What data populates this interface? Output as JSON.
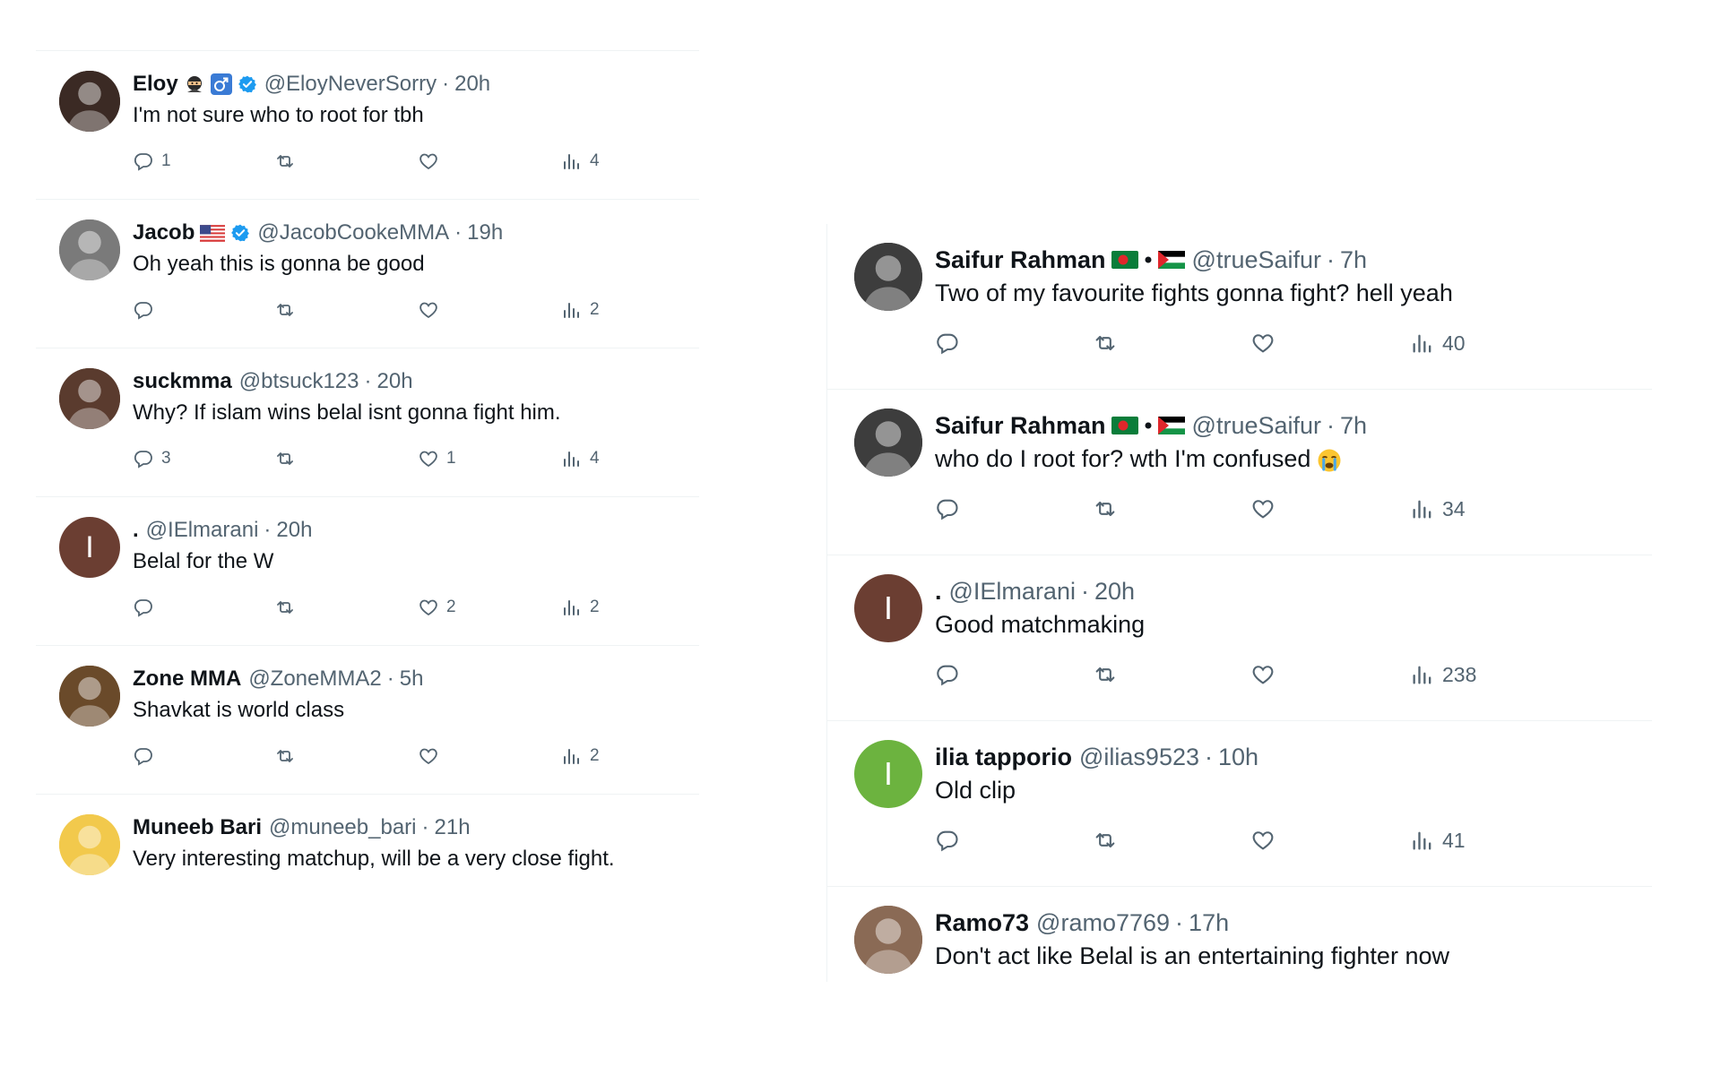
{
  "left_tweets": [
    {
      "name": "Eloy",
      "handle": "@EloyNeverSorry",
      "time": "20h",
      "text": "I'm not sure who to root for tbh",
      "replies": "1",
      "likes": "",
      "views": "4",
      "verified": true,
      "badges": [
        "ninja-emoji",
        "male-sign-emoji"
      ],
      "avatar": {
        "kind": "image",
        "icon": "avatar-eloy-icon",
        "color": "#3b2a24"
      }
    },
    {
      "name": "Jacob",
      "handle": "@JacobCookeMMA",
      "time": "19h",
      "text": "Oh yeah this is gonna be good",
      "replies": "",
      "likes": "",
      "views": "2",
      "verified": true,
      "badges": [
        "us-flag"
      ],
      "avatar": {
        "kind": "image",
        "icon": "avatar-jacob-icon",
        "color": "#7a7a7a"
      }
    },
    {
      "name": "suckmma",
      "handle": "@btsuck123",
      "time": "20h",
      "text": "Why? If islam wins belal isnt gonna fight him.",
      "replies": "3",
      "likes": "1",
      "views": "4",
      "verified": false,
      "badges": [],
      "avatar": {
        "kind": "image",
        "icon": "avatar-suckmma-icon",
        "color": "#5a3b2e"
      }
    },
    {
      "name": ".",
      "handle": "@IElmarani",
      "time": "20h",
      "text": "Belal for the W",
      "replies": "",
      "likes": "2",
      "views": "2",
      "verified": false,
      "badges": [],
      "avatar": {
        "kind": "letter",
        "letter": "I",
        "color": "#6b3e32"
      }
    },
    {
      "name": "Zone MMA",
      "handle": "@ZoneMMA2",
      "time": "5h",
      "text": "Shavkat is world class",
      "replies": "",
      "likes": "",
      "views": "2",
      "verified": false,
      "badges": [],
      "avatar": {
        "kind": "image",
        "icon": "avatar-zonemma-icon",
        "color": "#6a4a2a"
      }
    },
    {
      "name": "Muneeb Bari",
      "handle": "@muneeb_bari",
      "time": "21h",
      "text": "Very interesting matchup, will be a very close fight.",
      "replies": "",
      "likes": "",
      "views": "",
      "verified": false,
      "badges": [],
      "avatar": {
        "kind": "image",
        "icon": "avatar-muneeb-icon",
        "color": "#f2c94c"
      }
    }
  ],
  "right_tweets": [
    {
      "name": "Saifur Rahman",
      "handle": "@trueSaifur",
      "time": "7h",
      "text": "Two of my favourite fights gonna fight? hell yeah",
      "replies": "",
      "likes": "",
      "views": "40",
      "flags": [
        "bangladesh-flag",
        "bullet",
        "palestine-flag"
      ],
      "avatar": {
        "kind": "image",
        "icon": "avatar-saifur-icon",
        "color": "#3d3d3d"
      }
    },
    {
      "name": "Saifur Rahman",
      "handle": "@trueSaifur",
      "time": "7h",
      "text": "who do I root for? wth I'm confused",
      "emoji": "crying-face-emoji",
      "replies": "",
      "likes": "",
      "views": "34",
      "flags": [
        "bangladesh-flag",
        "bullet",
        "palestine-flag"
      ],
      "avatar": {
        "kind": "image",
        "icon": "avatar-saifur-icon",
        "color": "#3d3d3d"
      }
    },
    {
      "name": ".",
      "handle": "@IElmarani",
      "time": "20h",
      "text": "Good matchmaking",
      "replies": "",
      "likes": "",
      "views": "238",
      "flags": [],
      "avatar": {
        "kind": "letter",
        "letter": "I",
        "color": "#6b3e32"
      }
    },
    {
      "name": "ilia tapporio",
      "handle": "@ilias9523",
      "time": "10h",
      "text": "Old clip",
      "replies": "",
      "likes": "",
      "views": "41",
      "flags": [],
      "avatar": {
        "kind": "letter",
        "letter": "I",
        "color": "#6cb33f"
      }
    },
    {
      "name": "Ramo73",
      "handle": "@ramo7769",
      "time": "17h",
      "text": "Don't act like Belal is an entertaining fighter now",
      "replies": "",
      "likes": "",
      "views": "",
      "flags": [],
      "avatar": {
        "kind": "image",
        "icon": "avatar-ramo-icon",
        "color": "#8a6a55"
      }
    }
  ],
  "ui": {
    "separator": "·",
    "verified_color": "#1d9bf0",
    "muted_color": "#536471"
  }
}
